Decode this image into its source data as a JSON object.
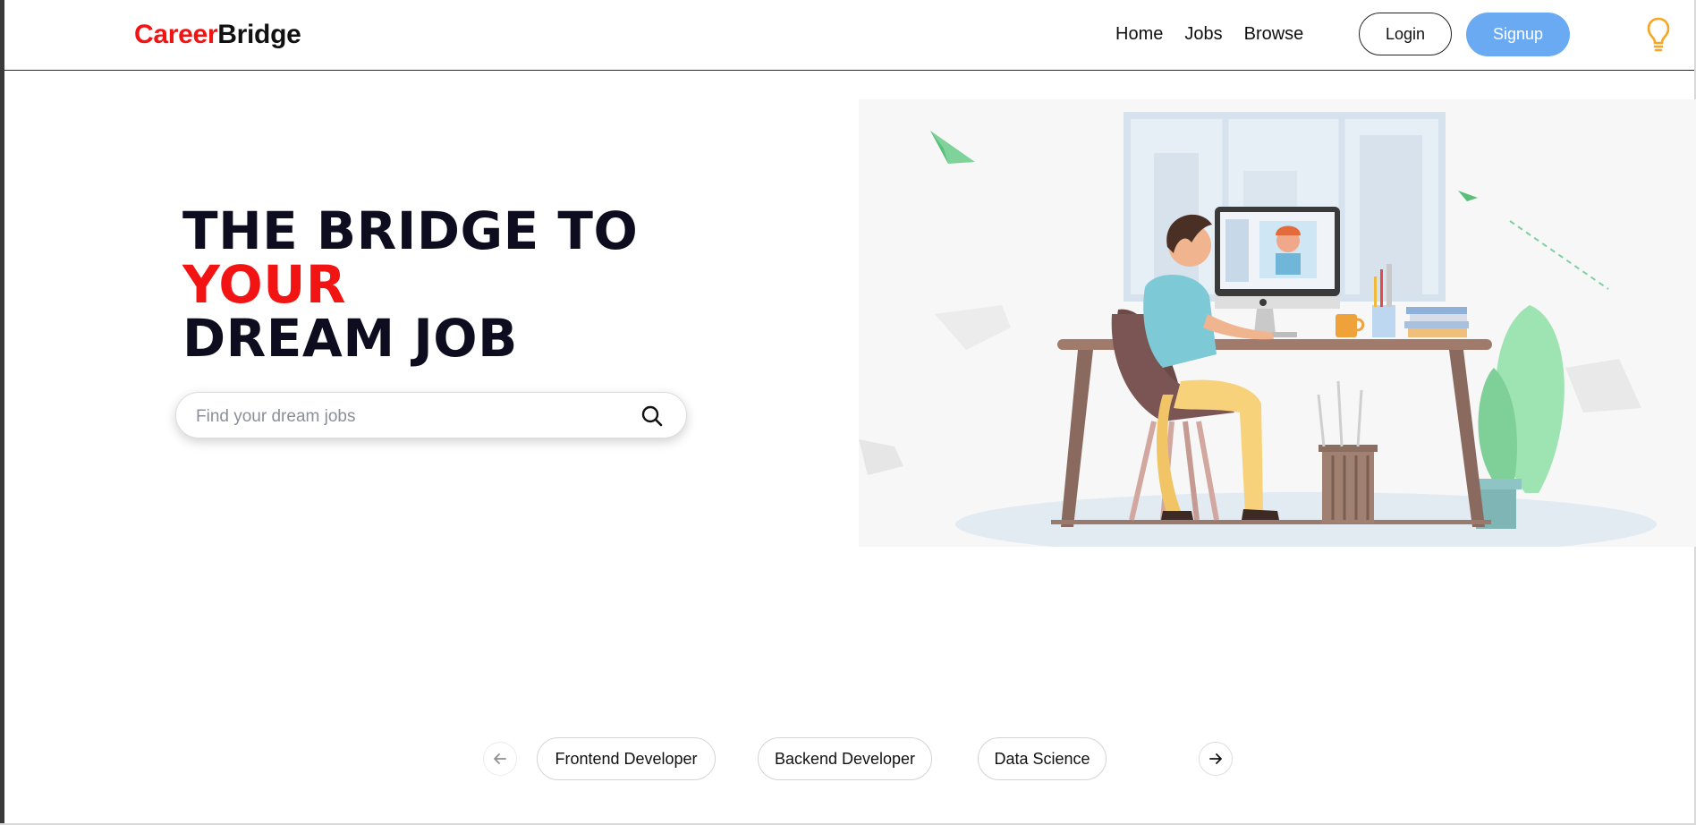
{
  "brand": {
    "part1": "Career",
    "part2": "Bridge",
    "accent_color": "#f21313"
  },
  "nav": {
    "items": [
      {
        "label": "Home"
      },
      {
        "label": "Jobs"
      },
      {
        "label": "Browse"
      }
    ]
  },
  "auth": {
    "login_label": "Login",
    "signup_label": "Signup",
    "signup_color": "#6aaaf2"
  },
  "theme_toggle": {
    "icon": "lightbulb-icon",
    "color": "#f5a623"
  },
  "hero": {
    "line1": "THE BRIDGE TO",
    "line2": "YOUR",
    "line3": "DREAM JOB"
  },
  "search": {
    "placeholder": "Find your dream jobs",
    "value": "",
    "icon": "search-icon"
  },
  "illustration": {
    "icon": "person-at-desk-illustration"
  },
  "categories": {
    "prev_icon": "arrow-left-icon",
    "next_icon": "arrow-right-icon",
    "items": [
      {
        "label": "Frontend Developer"
      },
      {
        "label": "Backend Developer"
      },
      {
        "label": "Data Science"
      }
    ]
  }
}
